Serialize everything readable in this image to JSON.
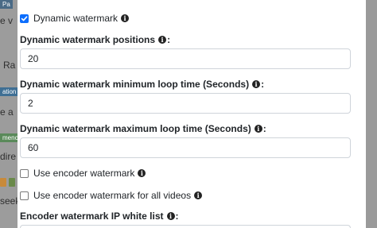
{
  "background_page": {
    "fragments": [
      "e v",
      "Ra",
      "e a",
      "dire",
      "seek"
    ],
    "badges": [
      "Pa",
      "ation",
      "menc"
    ]
  },
  "modal": {
    "dynamic_watermark": {
      "label": "Dynamic watermark",
      "checked": true
    },
    "positions": {
      "label": "Dynamic watermark positions",
      "value": "20"
    },
    "min_loop": {
      "label": "Dynamic watermark minimum loop time (Seconds)",
      "value": "2"
    },
    "max_loop": {
      "label": "Dynamic watermark maximum loop time (Seconds)",
      "value": "60"
    },
    "encoder_watermark": {
      "label": "Use encoder watermark",
      "checked": false
    },
    "encoder_all_videos": {
      "label": "Use encoder watermark for all videos",
      "checked": false
    },
    "ip_white_list": {
      "label": "Encoder watermark IP white list"
    }
  },
  "colors": {
    "checkbox_accent": "#0d6efd",
    "backdrop": "#9c9c9c",
    "input_border": "#cfd4da"
  },
  "icons": [
    "info-icon",
    "check-icon"
  ]
}
